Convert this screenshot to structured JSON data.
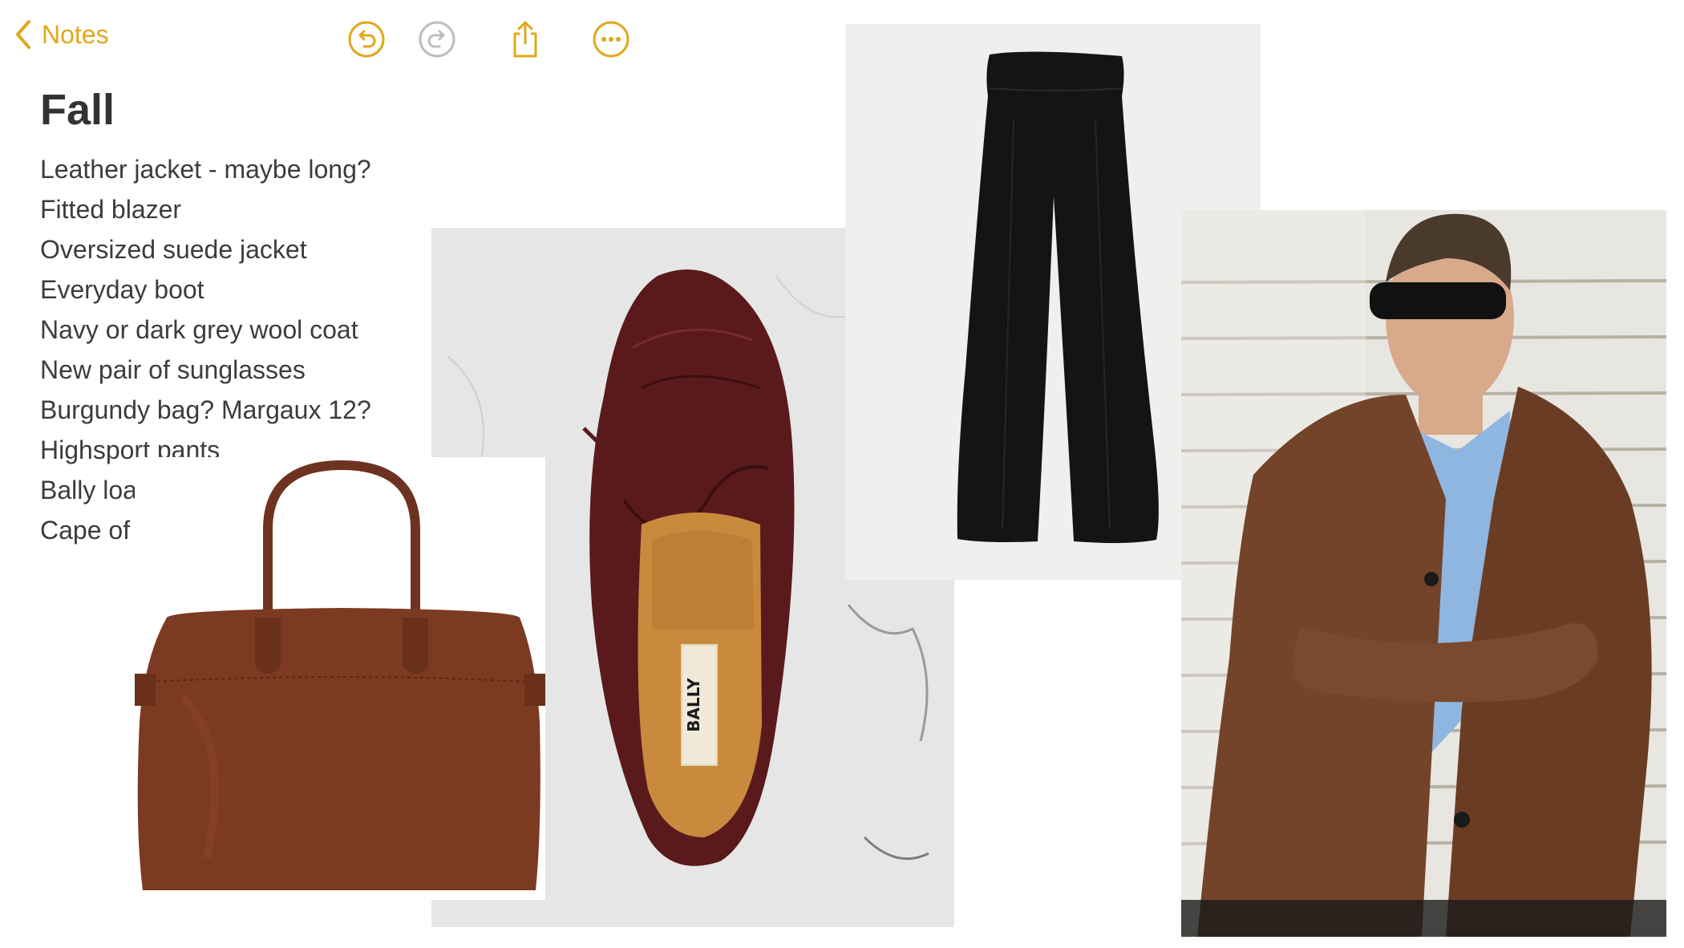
{
  "toolbar": {
    "back_label": "Notes",
    "accent_color": "#e0a81b",
    "icons": [
      "chevron-left-icon",
      "undo-icon",
      "redo-icon",
      "share-icon",
      "more-icon"
    ]
  },
  "note": {
    "title": "Fall",
    "items": [
      "Leather jacket - maybe long?",
      "Fitted blazer",
      "Oversized suede jacket",
      "Everyday boot",
      "Navy or dark grey wool coat",
      "New pair of sunglasses",
      "Burgundy bag? Margaux 12?",
      "Highsport pants",
      "Bally loafer",
      "Cape of some sort"
    ]
  },
  "images": {
    "shoe_brand": "BALLY"
  }
}
